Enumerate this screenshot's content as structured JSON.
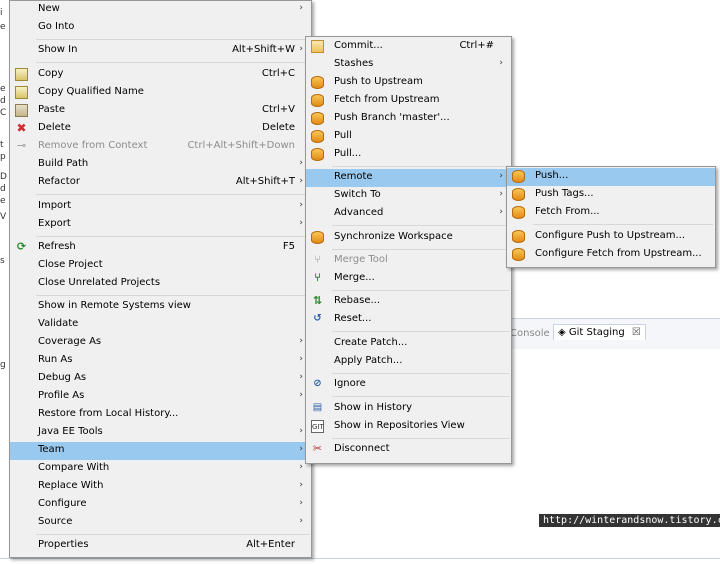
{
  "context_menu": {
    "items": [
      {
        "label": "New",
        "shortcut": "",
        "has_submenu": true
      },
      {
        "label": "Go Into",
        "shortcut": "",
        "has_submenu": false
      },
      {
        "label": "Show In",
        "shortcut": "Alt+Shift+W",
        "has_submenu": true
      },
      {
        "label": "Copy",
        "shortcut": "Ctrl+C",
        "has_submenu": false
      },
      {
        "label": "Copy Qualified Name",
        "shortcut": "",
        "has_submenu": false
      },
      {
        "label": "Paste",
        "shortcut": "Ctrl+V",
        "has_submenu": false
      },
      {
        "label": "Delete",
        "shortcut": "Delete",
        "has_submenu": false
      },
      {
        "label": "Remove from Context",
        "shortcut": "Ctrl+Alt+Shift+Down",
        "has_submenu": false,
        "disabled": true
      },
      {
        "label": "Build Path",
        "shortcut": "",
        "has_submenu": true
      },
      {
        "label": "Refactor",
        "shortcut": "Alt+Shift+T",
        "has_submenu": true
      },
      {
        "label": "Import",
        "shortcut": "",
        "has_submenu": true
      },
      {
        "label": "Export",
        "shortcut": "",
        "has_submenu": true
      },
      {
        "label": "Refresh",
        "shortcut": "F5",
        "has_submenu": false
      },
      {
        "label": "Close Project",
        "shortcut": "",
        "has_submenu": false
      },
      {
        "label": "Close Unrelated Projects",
        "shortcut": "",
        "has_submenu": false
      },
      {
        "label": "Show in Remote Systems view",
        "shortcut": "",
        "has_submenu": false
      },
      {
        "label": "Validate",
        "shortcut": "",
        "has_submenu": false
      },
      {
        "label": "Coverage As",
        "shortcut": "",
        "has_submenu": true
      },
      {
        "label": "Run As",
        "shortcut": "",
        "has_submenu": true
      },
      {
        "label": "Debug As",
        "shortcut": "",
        "has_submenu": true
      },
      {
        "label": "Profile As",
        "shortcut": "",
        "has_submenu": true
      },
      {
        "label": "Restore from Local History...",
        "shortcut": "",
        "has_submenu": false
      },
      {
        "label": "Java EE Tools",
        "shortcut": "",
        "has_submenu": true
      },
      {
        "label": "Team",
        "shortcut": "",
        "has_submenu": true,
        "highlighted": true
      },
      {
        "label": "Compare With",
        "shortcut": "",
        "has_submenu": true
      },
      {
        "label": "Replace With",
        "shortcut": "",
        "has_submenu": true
      },
      {
        "label": "Configure",
        "shortcut": "",
        "has_submenu": true
      },
      {
        "label": "Source",
        "shortcut": "",
        "has_submenu": true
      },
      {
        "label": "Properties",
        "shortcut": "Alt+Enter",
        "has_submenu": false
      }
    ],
    "icons": {
      "copy": "copy-icon",
      "copy_qualified": "copy-qualified-name-icon",
      "paste": "paste-icon",
      "delete": "delete-icon",
      "remove_context": "remove-from-context-icon",
      "refresh": "refresh-icon"
    }
  },
  "team_menu": {
    "items": [
      {
        "label": "Commit...",
        "shortcut": "Ctrl+#",
        "has_submenu": false
      },
      {
        "label": "Stashes",
        "shortcut": "",
        "has_submenu": true
      },
      {
        "label": "Push to Upstream",
        "shortcut": "",
        "has_submenu": false
      },
      {
        "label": "Fetch from Upstream",
        "shortcut": "",
        "has_submenu": false
      },
      {
        "label": "Push Branch 'master'...",
        "shortcut": "",
        "has_submenu": false
      },
      {
        "label": "Pull",
        "shortcut": "",
        "has_submenu": false
      },
      {
        "label": "Pull...",
        "shortcut": "",
        "has_submenu": false
      },
      {
        "label": "Remote",
        "shortcut": "",
        "has_submenu": true,
        "highlighted": true
      },
      {
        "label": "Switch To",
        "shortcut": "",
        "has_submenu": true
      },
      {
        "label": "Advanced",
        "shortcut": "",
        "has_submenu": true
      },
      {
        "label": "Synchronize Workspace",
        "shortcut": "",
        "has_submenu": false
      },
      {
        "label": "Merge Tool",
        "shortcut": "",
        "has_submenu": false,
        "disabled": true
      },
      {
        "label": "Merge...",
        "shortcut": "",
        "has_submenu": false
      },
      {
        "label": "Rebase...",
        "shortcut": "",
        "has_submenu": false
      },
      {
        "label": "Reset...",
        "shortcut": "",
        "has_submenu": false
      },
      {
        "label": "Create Patch...",
        "shortcut": "",
        "has_submenu": false
      },
      {
        "label": "Apply Patch...",
        "shortcut": "",
        "has_submenu": false
      },
      {
        "label": "Ignore",
        "shortcut": "",
        "has_submenu": false
      },
      {
        "label": "Show in History",
        "shortcut": "",
        "has_submenu": false
      },
      {
        "label": "Show in Repositories View",
        "shortcut": "",
        "has_submenu": false
      },
      {
        "label": "Disconnect",
        "shortcut": "",
        "has_submenu": false
      }
    ]
  },
  "remote_menu": {
    "items": [
      {
        "label": "Push...",
        "highlighted": true
      },
      {
        "label": "Push Tags..."
      },
      {
        "label": "Fetch From..."
      },
      {
        "label": "Configure Push to Upstream..."
      },
      {
        "label": "Configure Fetch from Upstream..."
      }
    ]
  },
  "background": {
    "tab_console": "Console",
    "tab_git_staging": "Git Staging",
    "tab_close_glyph": "☒",
    "watermark": "http://winterandsnow.tistory.com"
  },
  "glyphs": {
    "submenu_arrow": "›",
    "delete": "✖",
    "refresh": "⟳",
    "merge": "⑂",
    "rebase": "⇅",
    "reset": "↺",
    "ignore": "⊘",
    "disconnect": "✂",
    "sync": "⇄",
    "history": "▤"
  },
  "colors": {
    "menu_bg": "#f0f0f0",
    "highlight": "#99c9ef",
    "disabled_text": "#8d8d8d",
    "separator": "#d7d7d7"
  }
}
